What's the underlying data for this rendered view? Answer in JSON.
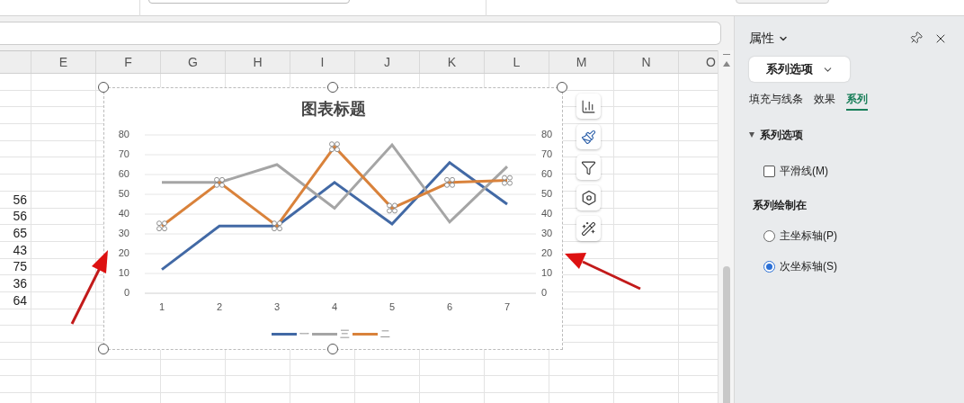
{
  "sheet": {
    "columns": [
      "E",
      "F",
      "G",
      "H",
      "I",
      "J",
      "K",
      "L",
      "M",
      "N",
      "O"
    ],
    "cells": [
      "56",
      "56",
      "65",
      "43",
      "75",
      "36",
      "64"
    ]
  },
  "chart": {
    "series_selection": [
      {
        "selected": false
      },
      {
        "selected": false
      },
      {
        "selected": true
      }
    ],
    "chart_data": {
      "type": "line",
      "title": "图表标题",
      "categories": [
        "1",
        "2",
        "3",
        "4",
        "5",
        "6",
        "7"
      ],
      "ylim": [
        0,
        80
      ],
      "yticks": [
        0,
        10,
        20,
        30,
        40,
        50,
        60,
        70,
        80
      ],
      "grid": true,
      "legend": "bottom",
      "series": [
        {
          "name": "一",
          "color": "#4269a5",
          "values": [
            12,
            34,
            34,
            56,
            35,
            66,
            45
          ]
        },
        {
          "name": "三",
          "color": "#a5a5a5",
          "values": [
            56,
            56,
            65,
            43,
            75,
            36,
            64
          ]
        },
        {
          "name": "二",
          "color": "#d9823b",
          "values": [
            34,
            56,
            34,
            74,
            43,
            56,
            57
          ]
        }
      ]
    },
    "right_axis_ticks": [
      "80",
      "70",
      "60",
      "50",
      "40",
      "30",
      "20",
      "10",
      "0"
    ]
  },
  "panel": {
    "title": "属性",
    "dropdown": "系列选项",
    "tabs": [
      {
        "label": "填充与线条",
        "selected": false
      },
      {
        "label": "效果",
        "selected": false
      },
      {
        "label": "系列",
        "selected": true
      }
    ],
    "section": {
      "title": "系列选项",
      "expanded": true
    },
    "smooth": {
      "label": "平滑线(M)",
      "checked": false
    },
    "plot_on_label": "系列绘制在",
    "axes": [
      {
        "label": "主坐标轴(P)",
        "selected": false
      },
      {
        "label": "次坐标轴(S)",
        "selected": true
      }
    ]
  }
}
